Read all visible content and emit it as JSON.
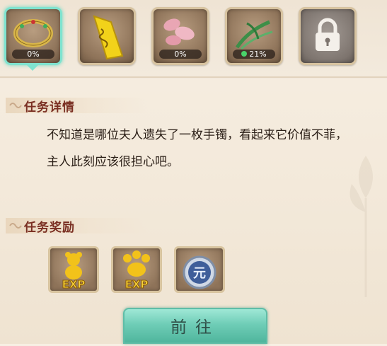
{
  "quest_items": [
    {
      "name": "bracelet",
      "progress": "0%",
      "state": "selected"
    },
    {
      "name": "yellow-scroll",
      "progress": null,
      "state": "normal"
    },
    {
      "name": "petals",
      "progress": "0%",
      "state": "normal"
    },
    {
      "name": "green-grass",
      "progress": "21%",
      "state": "normal"
    },
    {
      "name": "locked-slot",
      "progress": null,
      "state": "locked"
    }
  ],
  "details": {
    "title": "任务详情",
    "text": "不知道是哪位夫人遗失了一枚手镯，看起来它价值不菲，主人此刻应该很担心吧。"
  },
  "rewards": {
    "title": "任务奖励",
    "items": [
      {
        "icon": "exp-bear-icon",
        "label": "EXP"
      },
      {
        "icon": "exp-paw-icon",
        "label": "EXP"
      },
      {
        "icon": "silver-coin-icon",
        "label": "元"
      }
    ]
  },
  "button": {
    "label": "前往"
  },
  "colors": {
    "accent_teal": "#7fe3cf",
    "title_red": "#7a2f22",
    "background": "#f3e9da"
  }
}
